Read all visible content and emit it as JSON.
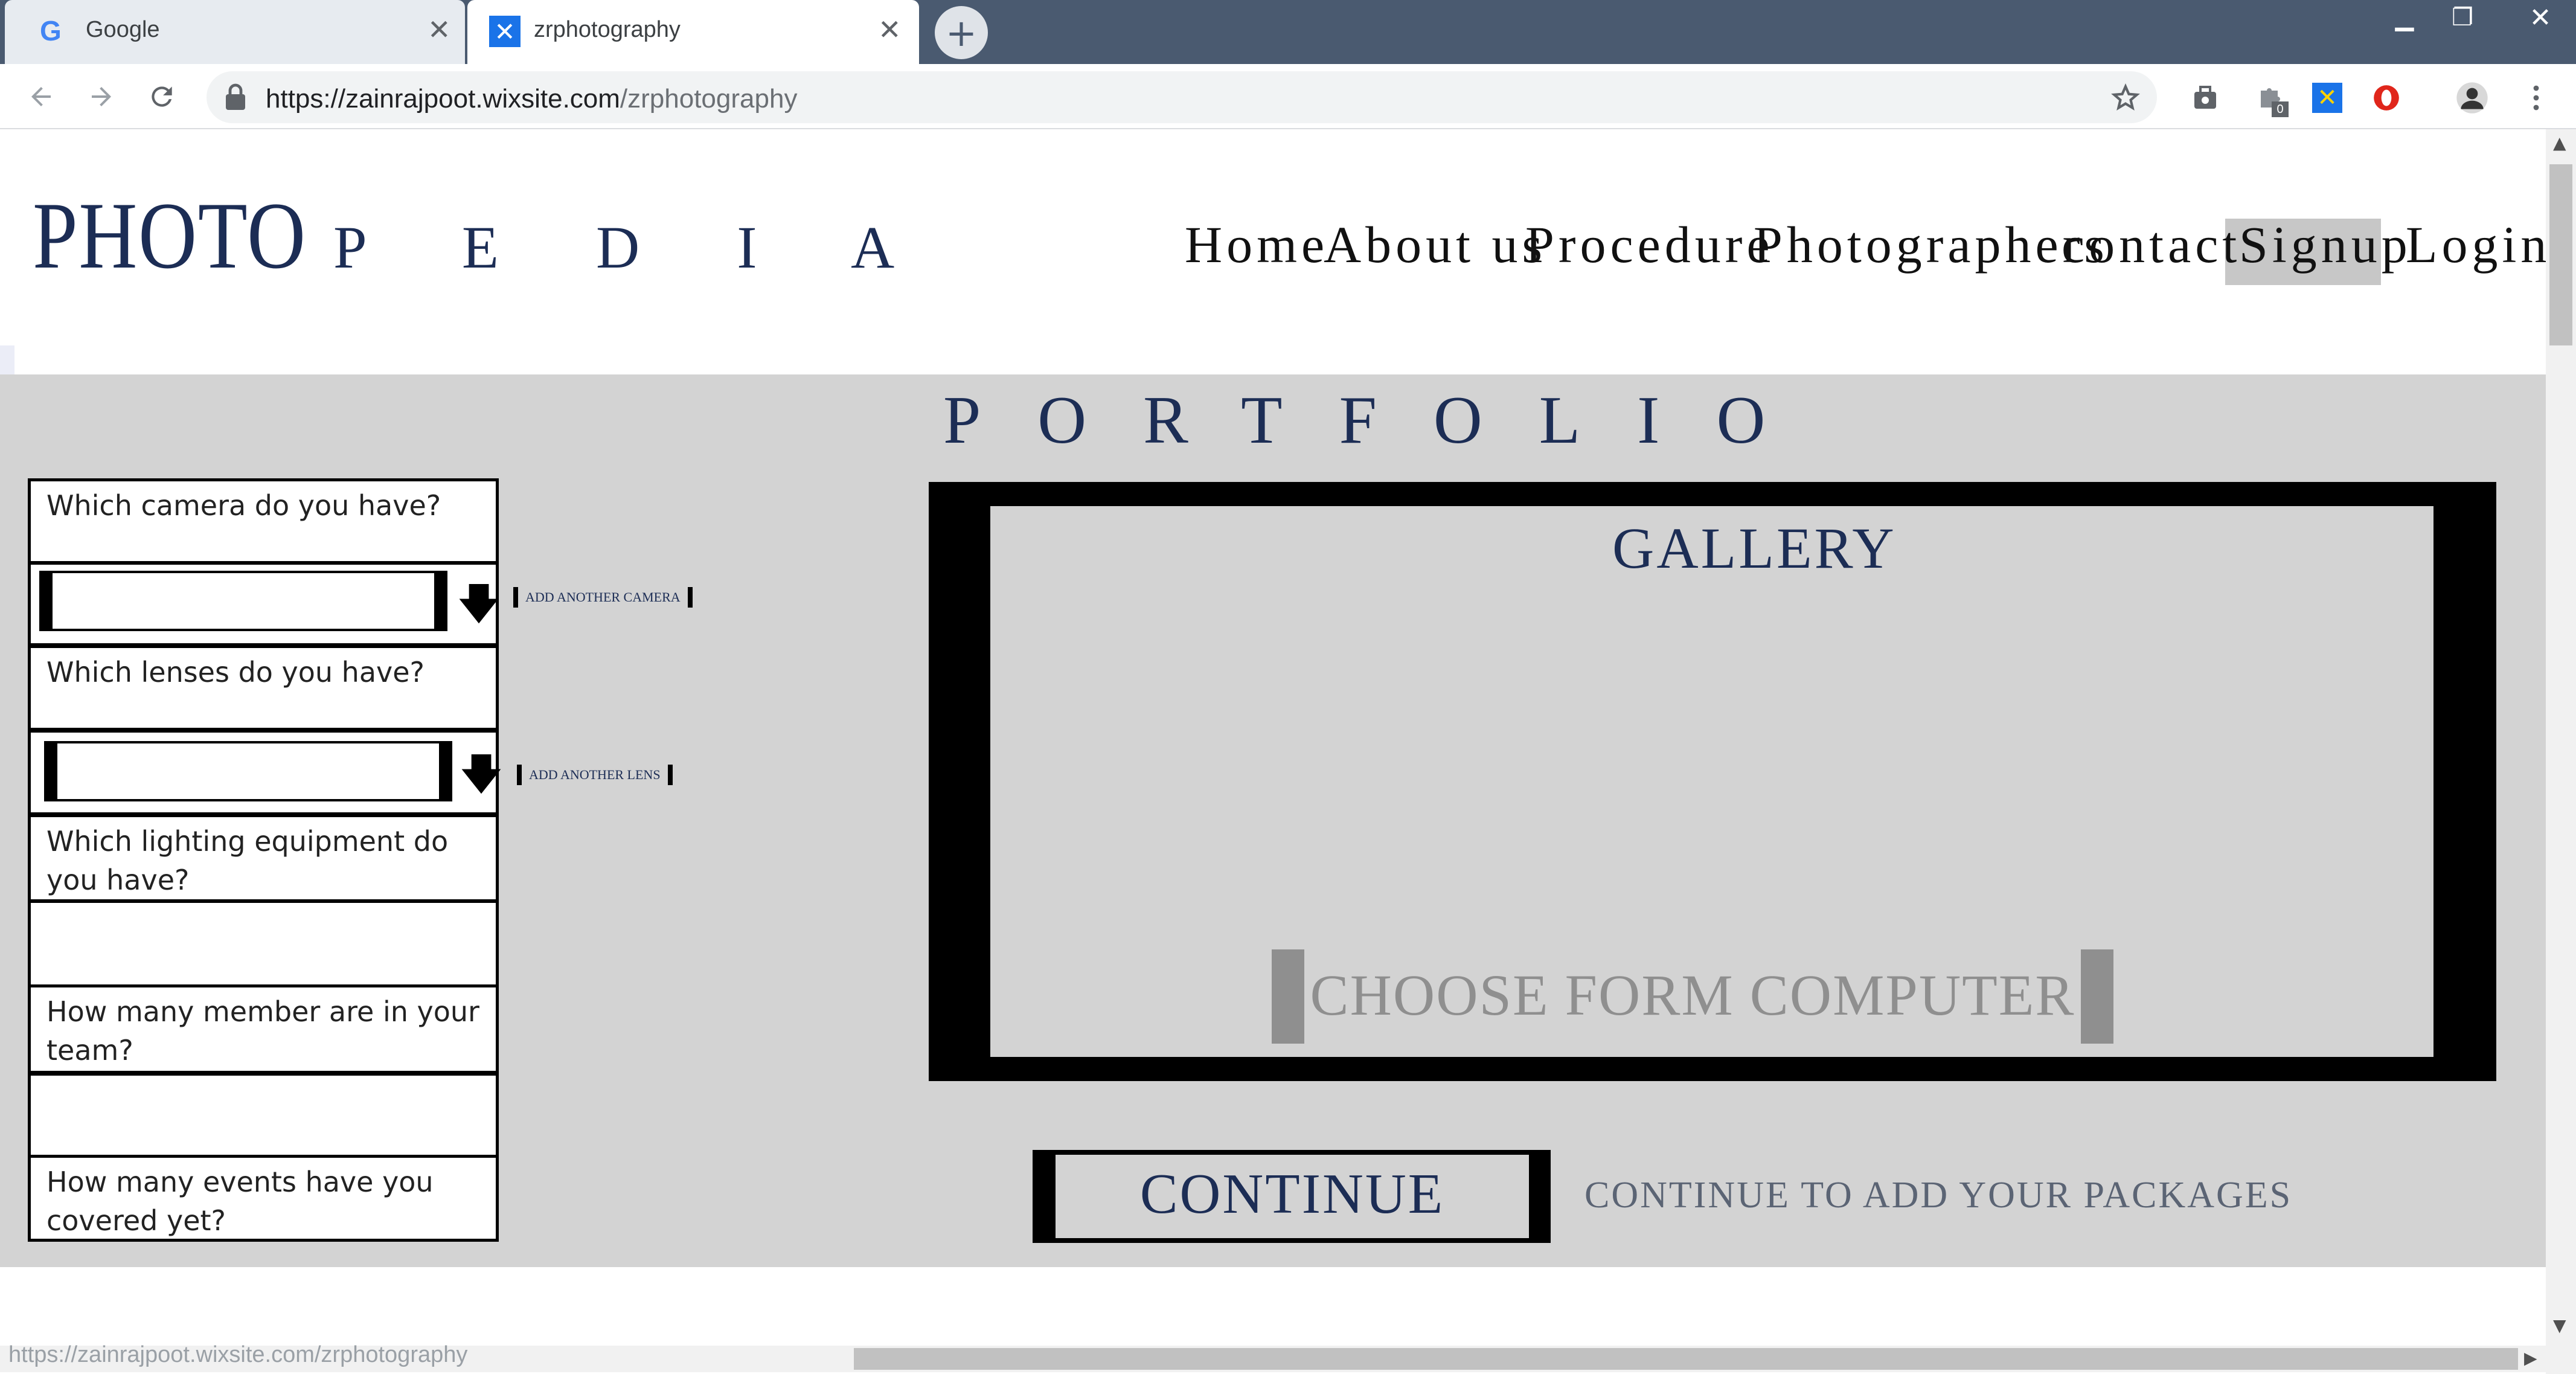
{
  "browser": {
    "tabs": [
      {
        "title": "Google",
        "icon": "google-g-icon",
        "active": false
      },
      {
        "title": "zrphotography",
        "icon": "wix-x-icon",
        "active": true
      }
    ],
    "url_host": "https://zainrajpoot.wixsite.com",
    "url_path": "/zrphotography",
    "window_controls": [
      "minimize",
      "restore",
      "close"
    ]
  },
  "site": {
    "logo_main": "PHOTO",
    "logo_sub": "P E D I A",
    "nav": [
      "Home",
      "About us",
      "Procedure",
      "Photographers",
      "contact",
      "Signup",
      "Login"
    ],
    "nav_active": "Signup"
  },
  "portfolio": {
    "heading": "PORTFOLIO",
    "questions": {
      "camera": "Which camera do you have?",
      "lenses": "Which lenses do you have?",
      "lighting": "Which lighting equipment do you have?",
      "team": "How many member are in your team?",
      "events": "How many events have you covered yet?"
    },
    "add_camera": "ADD ANOTHER CAMERA",
    "add_lens": "ADD ANOTHER LENS",
    "gallery_title": "GALLERY",
    "choose_button": "CHOOSE FORM COMPUTER",
    "continue_button": "CONTINUE",
    "continue_note": "CONTINUE TO ADD YOUR PACKAGES"
  },
  "status_bar": {
    "url": "https://zainrajpoot.wixsite.com/zrphotography"
  },
  "colors": {
    "brand_navy": "#1c2d55",
    "band_gray": "#d3d3d3",
    "button_gray": "#8f8f8f"
  }
}
